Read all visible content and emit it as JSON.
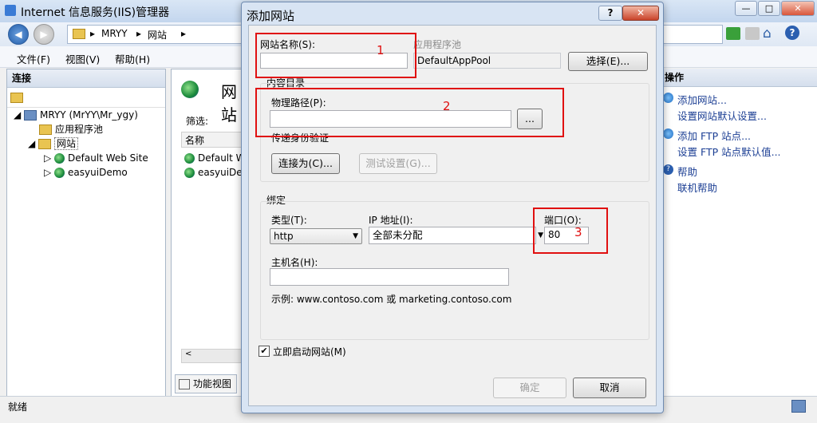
{
  "window": {
    "title": "Internet 信息服务(IIS)管理器"
  },
  "nav": {
    "breadcrumb": [
      "MRYY",
      "网站"
    ]
  },
  "menu": [
    "文件(F)",
    "视图(V)",
    "帮助(H)"
  ],
  "left_panel": {
    "header": "连接",
    "tree": [
      "MRYY (MrYY\\Mr_ygy)",
      "应用程序池",
      "网站",
      "Default Web Site",
      "easyuiDemo"
    ]
  },
  "middle_panel": {
    "title": "网站",
    "filter_label": "筛选:",
    "column_name": "名称",
    "rows": [
      "Default W",
      "easyuiDem"
    ],
    "bottom_tab": "功能视图"
  },
  "right_panel": {
    "header": "操作",
    "actions": [
      "添加网站...",
      "设置网站默认设置...",
      "添加 FTP 站点...",
      "设置 FTP 站点默认值...",
      "帮助",
      "联机帮助"
    ]
  },
  "status": {
    "text": "就绪"
  },
  "dialog": {
    "title": "添加网站",
    "help_button": "?",
    "site_name_label": "网站名称(S):",
    "site_name_value": "",
    "app_pool_label": "应用程序池",
    "app_pool_value": "DefaultAppPool",
    "select_button": "选择(E)...",
    "content_dir_label": "内容目录",
    "physical_path_label": "物理路径(P):",
    "physical_path_value": "",
    "browse_button": "...",
    "passthrough_label": "传递身份验证",
    "connect_as_button": "连接为(C)...",
    "test_settings_button": "测试设置(G)...",
    "binding_label": "绑定",
    "type_label": "类型(T):",
    "type_value": "http",
    "ip_label": "IP 地址(I):",
    "ip_value": "全部未分配",
    "port_label": "端口(O):",
    "port_value": "80",
    "host_label": "主机名(H):",
    "host_value": "",
    "example_text": "示例: www.contoso.com 或 marketing.contoso.com",
    "start_checkbox_label": "立即启动网站(M)",
    "start_checked": true,
    "ok_button": "确定",
    "cancel_button": "取消"
  },
  "annotations": [
    "1",
    "2",
    "3"
  ],
  "colors": {
    "annotation_red": "#e01010",
    "link_blue": "#1c3f94"
  }
}
